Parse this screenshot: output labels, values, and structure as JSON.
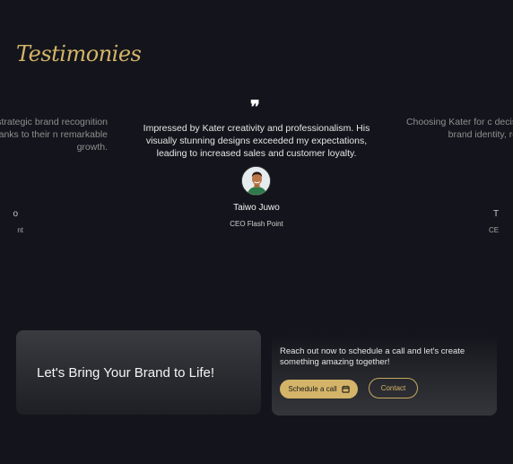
{
  "testimonials": {
    "title": "Testimonies",
    "quote_icon": "quote-icon",
    "main": {
      "text": "Impressed by Kater creativity and professionalism. His visually stunning designs exceeded my expectations, leading to increased sales and customer loyalty.",
      "name": "Taiwo Juwo",
      "role": "CEO  Flash Point",
      "avatar_icon": "avatar-portrait"
    },
    "left_partial": {
      "text": "r for us. Their strategic brand recognition and antly. Thanks to their n remarkable growth.",
      "name": "o",
      "role": "nt"
    },
    "right_partial": {
      "text": "Choosing Kater for c decision. Their tailored brand identity, resultin a",
      "name": "T",
      "role": "CE"
    }
  },
  "cta": {
    "heading": "Let's Bring Your Brand to Life!",
    "copy": "Reach out now to schedule a call and let's create something amazing together!",
    "schedule_label": "Schedule a call",
    "contact_label": "Contact",
    "accent_color": "#d4b468"
  }
}
